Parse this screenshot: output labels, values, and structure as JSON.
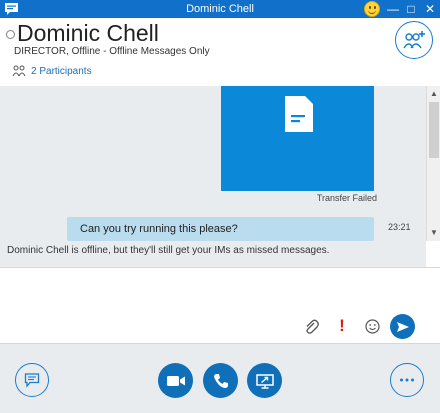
{
  "window": {
    "title": "Dominic Chell",
    "controls": {
      "minimize": "—",
      "maximize": "□",
      "close": "✕"
    }
  },
  "header": {
    "name": "Dominic Chell",
    "status": "DIRECTOR, Offline - Offline Messages Only",
    "participants_label": "2 Participants"
  },
  "conversation": {
    "file_transfer": {
      "status": "Transfer Failed"
    },
    "messages": [
      {
        "text": "Can you try running this please?",
        "time": "23:21"
      }
    ],
    "offline_notice": "Dominic Chell is offline, but they'll still get your IMs as missed messages."
  },
  "compose": {
    "placeholder": "",
    "important_mark": "!"
  },
  "colors": {
    "title_bar": "#1170c9",
    "accent": "#0f6fb8",
    "file_card": "#0c88d8",
    "bubble": "#b9dcef",
    "important": "#d81f1f"
  },
  "icons": {
    "app": "im-app-icon",
    "emoji": "smiley-icon",
    "add_people": "add-people-icon",
    "participants": "participants-icon",
    "file": "document-icon",
    "attach": "paperclip-icon",
    "emoticon": "emoticon-icon",
    "send": "send-icon",
    "im": "chat-icon",
    "video": "video-camera-icon",
    "call": "phone-icon",
    "present": "present-screen-icon",
    "more": "more-options-icon"
  }
}
